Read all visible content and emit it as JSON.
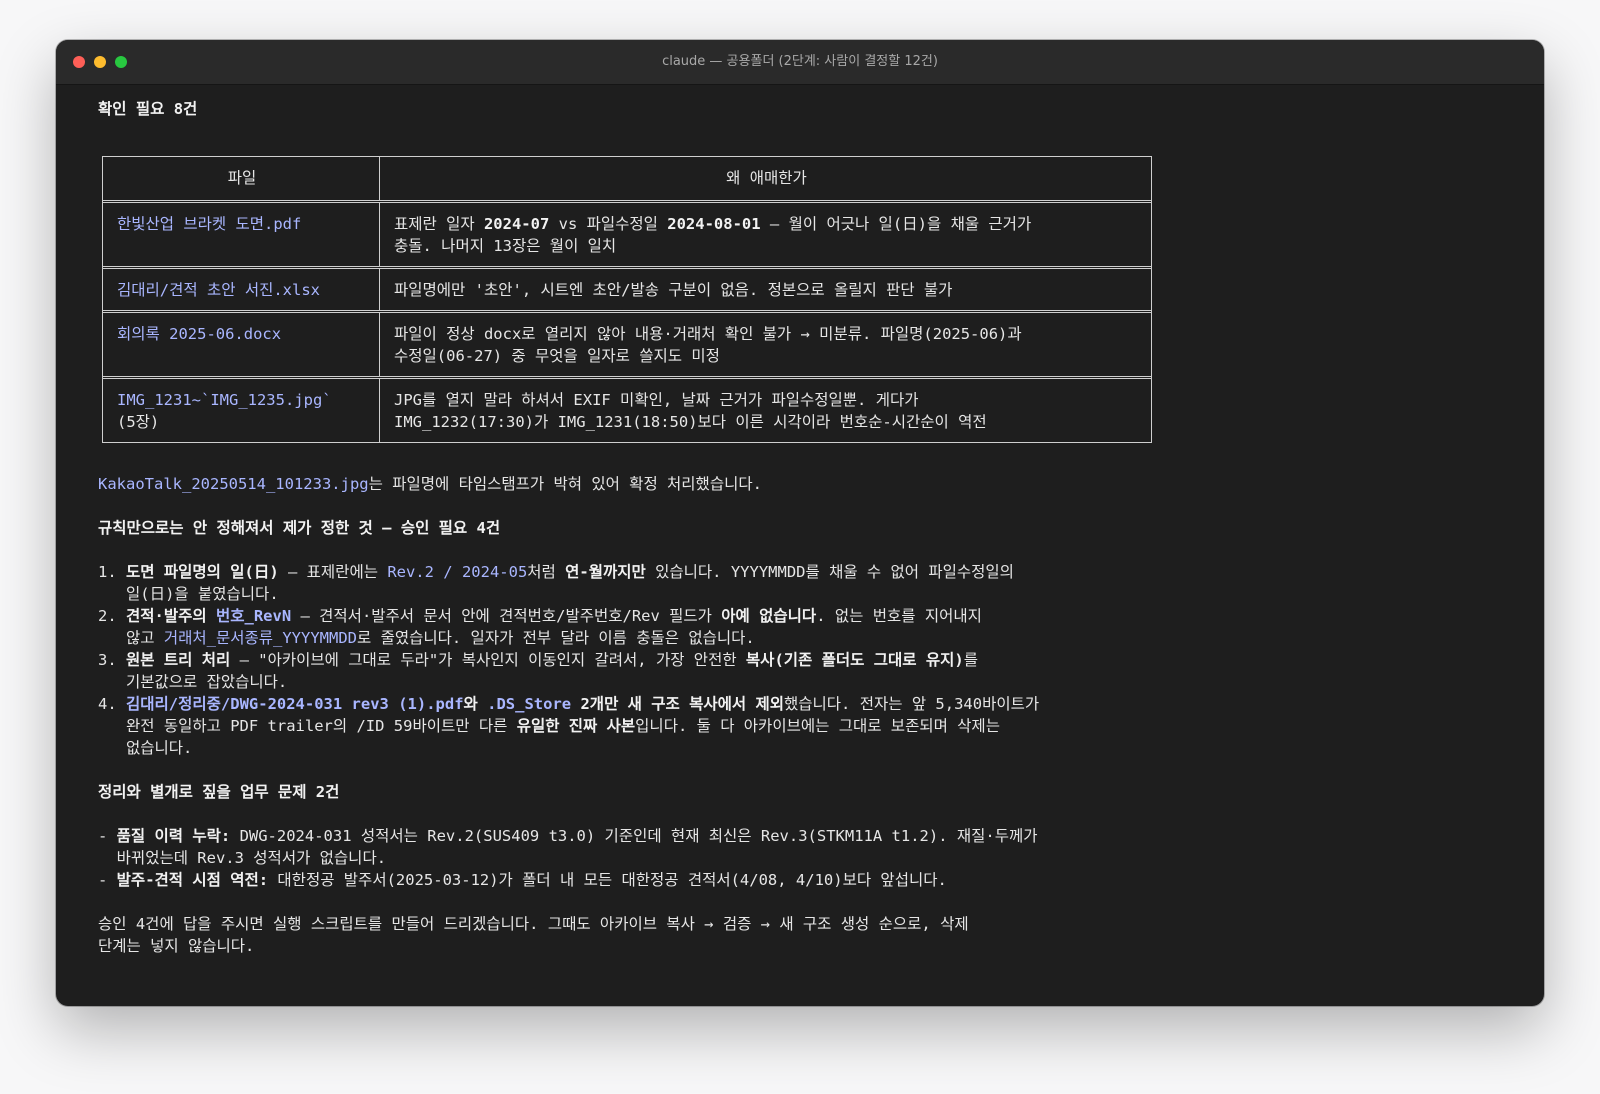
{
  "window": {
    "title": "claude — 공용폴더 (2단계: 사람이 결정할 12건)"
  },
  "section1": {
    "heading": "확인 필요 8건"
  },
  "table": {
    "headers": [
      "파일",
      "왜 애매한가"
    ],
    "rows": [
      {
        "file": "한빛산업 브라켓 도면.pdf",
        "reason_line1_a": "표제란 일자 ",
        "reason_line1_b": "2024-07",
        "reason_line1_c": " vs 파일수정일 ",
        "reason_line1_d": "2024-08-01",
        "reason_line1_e": " — 월이 어긋나 일(日)을 채울 근거가",
        "reason_line2": "충돌. 나머지 13장은 월이 일치"
      },
      {
        "file": "김대리/견적 초안 서진.xlsx",
        "reason_line1": "파일명에만 '초안', 시트엔 초안/발송 구분이 없음. 정본으로 올릴지 판단 불가"
      },
      {
        "file": "회의록 2025-06.docx",
        "reason_line1": "파일이 정상 docx로 열리지 않아 내용·거래처 확인 불가 → 미분류. 파일명(2025-06)과",
        "reason_line2": "수정일(06-27) 중 무엇을 일자로 쓸지도 미정"
      },
      {
        "file_line1": "IMG_1231~`IMG_1235.jpg`",
        "file_line2": "(5장)",
        "reason_line1": "JPG를 열지 말라 하셔서 EXIF 미확인, 날짜 근거가 파일수정일뿐. 게다가",
        "reason_line2": "IMG_1232(17:30)가 IMG_1231(18:50)보다 이른 시각이라 번호순-시간순이 역전"
      }
    ]
  },
  "kakao": {
    "file": "KakaoTalk_20250514_101233.jpg",
    "text": "는 파일명에 타임스탬프가 박혀 있어 확정 처리했습니다."
  },
  "section2": {
    "heading": "규칙만으로는 안 정해져서 제가 정한 것 — 승인 필요 4건"
  },
  "items": [
    {
      "num": "1.",
      "bold": "도면 파일명의 일(日)",
      "t1": " — 표제란에는 ",
      "link": "Rev.2 / 2024-05",
      "t2": "처럼 ",
      "bold2": "연-월까지만",
      "t3": " 있습니다. YYYYMMDD를 채울 수 없어 파일수정일의",
      "line2": "일(日)을 붙였습니다."
    },
    {
      "num": "2.",
      "bold": "견적·발주의 ",
      "blink": "번호_RevN",
      "t1": " — 견적서·발주서 문서 안에 견적번호/발주번호/Rev 필드가 ",
      "bold2": "아예 없습니다",
      "t2": ". 없는 번호를 지어내지",
      "l2a": "않고 ",
      "l2link": "거래처_문서종류_YYYYMMDD",
      "l2b": "로 줄였습니다. 일자가 전부 달라 이름 충돌은 없습니다."
    },
    {
      "num": "3.",
      "bold": "원본 트리 처리",
      "t1": " — \"아카이브에 그대로 두라\"가 복사인지 이동인지 갈려서, 가장 안전한 ",
      "bold2": "복사(기존 폴더도 그대로 유지)",
      "t2": "를",
      "line2": "기본값으로 잡았습니다."
    },
    {
      "num": "4.",
      "blink1": "김대리/정리중/DWG-2024-031 rev3 (1).pdf",
      "bold1": "와 ",
      "blink2": ".DS_Store",
      "bold2": " 2개만 새 구조 복사에서 제외",
      "t1": "했습니다. 전자는 앞 5,340바이트가",
      "l2a": "완전 동일하고 PDF trailer의 /ID 59바이트만 다른 ",
      "l2bold": "유일한 진짜 사본",
      "l2b": "입니다. 둘 다 아카이브에는 그대로 보존되며 삭제는",
      "line3": "없습니다."
    }
  ],
  "section3": {
    "heading": "정리와 별개로 짚을 업무 문제 2건"
  },
  "issues": [
    {
      "dash": "- ",
      "bold": "품질 이력 누락:",
      "t1": " DWG-2024-031 성적서는 Rev.2(SUS409 t3.0) 기준인데 현재 최신은 Rev.3(STKM11A t1.2). 재질·두께가",
      "line2": "바뀌었는데 Rev.3 성적서가 없습니다."
    },
    {
      "dash": "- ",
      "bold": "발주-견적 시점 역전:",
      "t1": " 대한정공 발주서(2025-03-12)가 폴더 내 모든 대한정공 견적서(4/08, 4/10)보다 앞섭니다."
    }
  ],
  "closing": {
    "line1": "승인 4건에 답을 주시면 실행 스크립트를 만들어 드리겠습니다. 그때도 아카이브 복사 → 검증 → 새 구조 생성 순으로, 삭제",
    "line2": "단계는 넣지 않습니다."
  }
}
